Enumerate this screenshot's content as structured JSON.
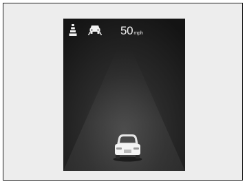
{
  "display": {
    "speed_value": "50",
    "speed_unit": "mph",
    "icons": [
      "lane-keeping-icon",
      "lane-departure-icon"
    ],
    "colors": {
      "background": "#ededed",
      "screen": "#1e1e1e",
      "icon": "#f2f2f2"
    }
  }
}
